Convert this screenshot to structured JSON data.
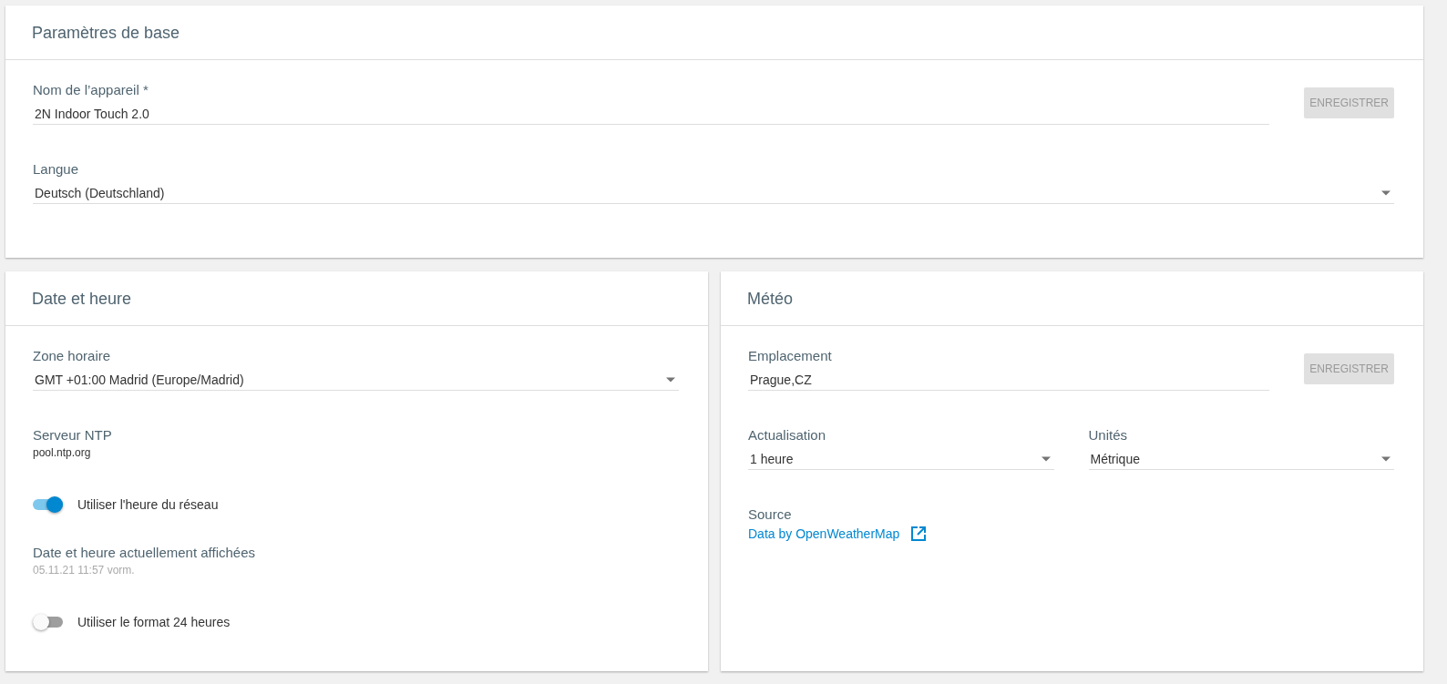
{
  "cards": [
    {
      "title": "Paramètres de base",
      "items": [
        {
          "kind": "text",
          "label": "Nom de l’appareil *",
          "value": "2N Indoor Touch 2.0",
          "button": {
            "label": "ENREGISTRER",
            "disabled": true
          }
        },
        {
          "kind": "select",
          "label": "Langue",
          "value": "Deutsch (Deutschland)"
        }
      ]
    },
    {
      "title": "Date et heure",
      "items": [
        {
          "kind": "select",
          "label": "Zone horaire",
          "value": "GMT +01:00 Madrid (Europe/Madrid)"
        },
        {
          "kind": "info",
          "label": "Serveur NTP",
          "value": "pool.ntp.org",
          "disabled": false
        },
        {
          "kind": "toggle",
          "label": "Utiliser l'heure du réseau",
          "on": true
        },
        {
          "kind": "info",
          "label": "Date et heure actuellement affichées",
          "value": "05.11.21 11:57 vorm.",
          "disabled": true
        },
        {
          "kind": "toggle",
          "label": "Utiliser le format 24 heures",
          "on": false
        }
      ]
    },
    {
      "title": "Météo",
      "items": [
        {
          "kind": "text",
          "label": "Emplacement",
          "value": "Prague,CZ",
          "button": {
            "label": "ENREGISTRER",
            "disabled": true
          }
        },
        {
          "kind": "pair",
          "fields": [
            {
              "label": "Actualisation",
              "value": "1 heure"
            },
            {
              "label": "Unités",
              "value": "Métrique"
            }
          ]
        },
        {
          "kind": "link",
          "label": "Source",
          "value": "Data by OpenWeatherMap"
        }
      ]
    }
  ]
}
